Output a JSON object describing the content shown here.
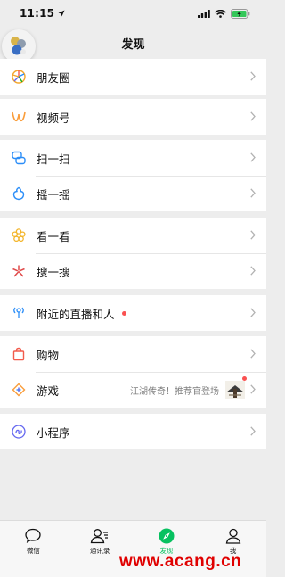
{
  "status_bar": {
    "time": "11:15"
  },
  "header": {
    "title": "发现"
  },
  "colors": {
    "accent": "#07c160",
    "badge": "#fa5151",
    "watermark": "#e00000"
  },
  "groups": [
    {
      "items": [
        {
          "label": "朋友圈",
          "icon": "moments-icon"
        }
      ]
    },
    {
      "items": [
        {
          "label": "视频号",
          "icon": "channels-icon"
        }
      ]
    },
    {
      "items": [
        {
          "label": "扫一扫",
          "icon": "scan-icon"
        },
        {
          "label": "摇一摇",
          "icon": "shake-icon"
        }
      ]
    },
    {
      "items": [
        {
          "label": "看一看",
          "icon": "top-stories-icon"
        },
        {
          "label": "搜一搜",
          "icon": "search-icon"
        }
      ]
    },
    {
      "items": [
        {
          "label": "附近的直播和人",
          "icon": "nearby-icon"
        }
      ]
    },
    {
      "items": [
        {
          "label": "购物",
          "icon": "shopping-icon"
        },
        {
          "label": "游戏",
          "icon": "games-icon",
          "extra_text": "江湖传奇！推荐官登场"
        }
      ]
    },
    {
      "items": [
        {
          "label": "小程序",
          "icon": "mini-programs-icon"
        }
      ]
    }
  ],
  "tabs": [
    {
      "label": "微信",
      "icon": "chats-icon"
    },
    {
      "label": "通讯录",
      "icon": "contacts-icon"
    },
    {
      "label": "发现",
      "icon": "discover-icon",
      "active": true
    },
    {
      "label": "我",
      "icon": "me-icon"
    }
  ],
  "watermark": "www.acang.cn"
}
